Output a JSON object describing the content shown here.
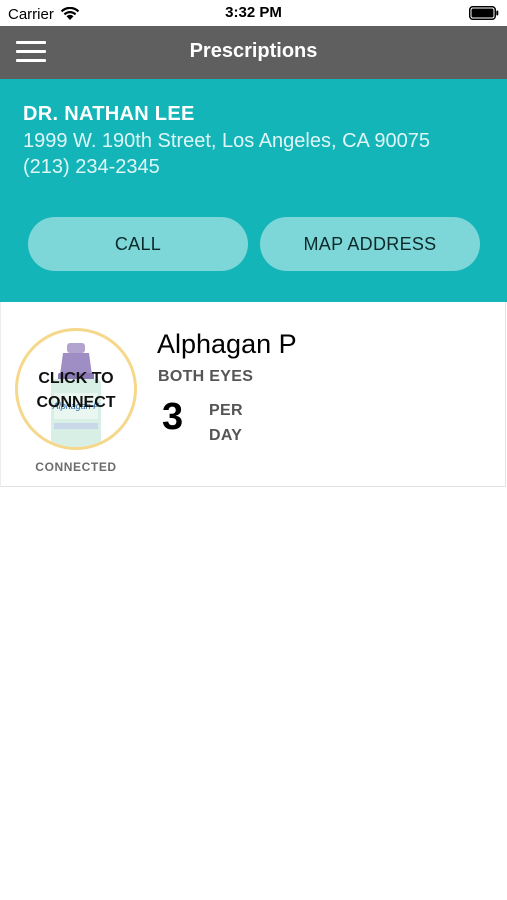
{
  "status_bar": {
    "carrier": "Carrier",
    "time": "3:32 PM"
  },
  "nav": {
    "title": "Prescriptions"
  },
  "doctor": {
    "name": "DR. NATHAN LEE",
    "address": "1999 W. 190th Street, Los Angeles, CA 90075",
    "phone": "(213) 234-2345",
    "call_label": "CALL",
    "map_label": "MAP ADDRESS"
  },
  "prescription": {
    "connect_line1": "CLICK TO",
    "connect_line2": "CONNECT",
    "status": "CONNECTED",
    "drug_name": "Alphagan P",
    "eyes": "BOTH EYES",
    "dose_count": "3",
    "dose_unit_line1": "PER",
    "dose_unit_line2": "DAY",
    "bottle_label": "Alphagan P"
  },
  "colors": {
    "nav_bg": "#5f5f5f",
    "doctor_panel_bg": "#14b5b8",
    "button_bg": "#7dd6d7",
    "connect_ring": "#f5d88b"
  },
  "icons": [
    "wifi-icon",
    "battery-icon",
    "hamburger-icon",
    "eye-drop-bottle-icon"
  ]
}
